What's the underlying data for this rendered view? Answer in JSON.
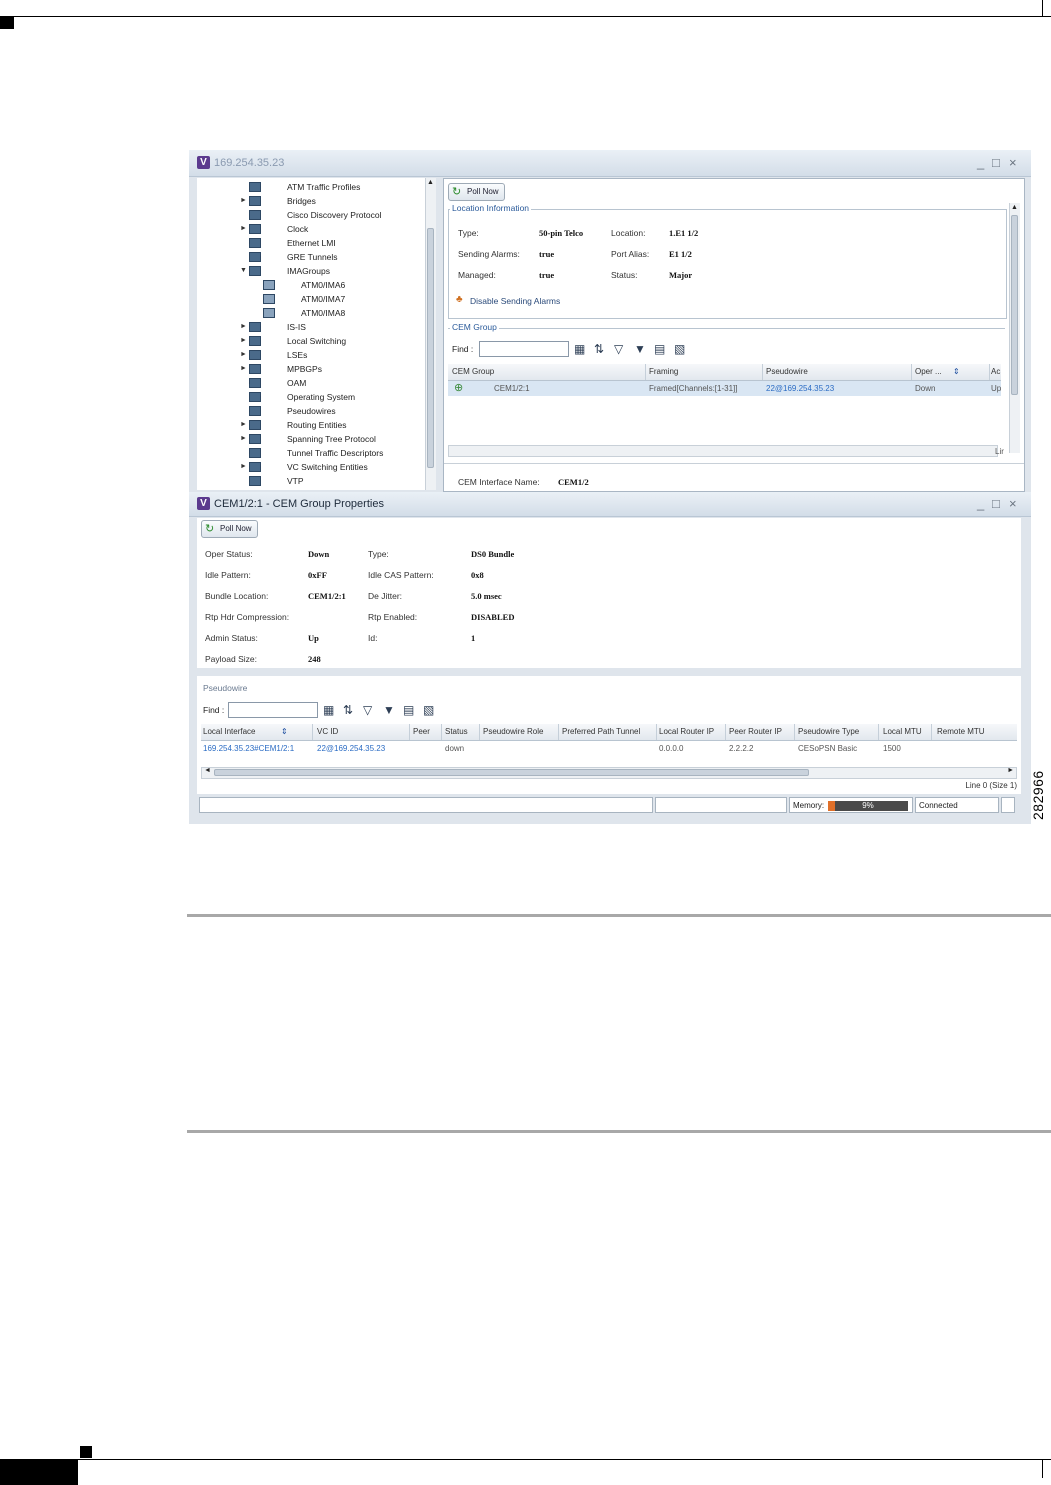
{
  "figure_id": "282966",
  "top_window": {
    "title": "169.254.35.23",
    "poll_now": "Poll Now",
    "tree": [
      {
        "label": "ATM Traffic Profiles",
        "expandable": false
      },
      {
        "label": "Bridges",
        "expandable": true
      },
      {
        "label": "Cisco Discovery Protocol",
        "expandable": false
      },
      {
        "label": "Clock",
        "expandable": true
      },
      {
        "label": "Ethernet LMI",
        "expandable": false
      },
      {
        "label": "GRE Tunnels",
        "expandable": false
      },
      {
        "label": "IMAGroups",
        "expandable": true,
        "expanded": true
      },
      {
        "label": "ATM0/IMA6",
        "child": true
      },
      {
        "label": "ATM0/IMA7",
        "child": true
      },
      {
        "label": "ATM0/IMA8",
        "child": true
      },
      {
        "label": "IS-IS",
        "expandable": true
      },
      {
        "label": "Local Switching",
        "expandable": true
      },
      {
        "label": "LSEs",
        "expandable": true
      },
      {
        "label": "MPBGPs",
        "expandable": true
      },
      {
        "label": "OAM",
        "expandable": false
      },
      {
        "label": "Operating System",
        "expandable": false
      },
      {
        "label": "Pseudowires",
        "expandable": false
      },
      {
        "label": "Routing Entities",
        "expandable": true
      },
      {
        "label": "Spanning Tree Protocol",
        "expandable": true
      },
      {
        "label": "Tunnel Traffic Descriptors",
        "expandable": false
      },
      {
        "label": "VC Switching Entities",
        "expandable": true
      },
      {
        "label": "VTP",
        "expandable": false
      }
    ],
    "location": {
      "section_title": "Location Information",
      "type_label": "Type:",
      "type_value": "50-pin Telco",
      "location_label": "Location:",
      "location_value": "1.E1 1/2",
      "sending_alarms_label": "Sending Alarms:",
      "sending_alarms_value": "true",
      "port_alias_label": "Port Alias:",
      "port_alias_value": "E1 1/2",
      "managed_label": "Managed:",
      "managed_value": "true",
      "status_label": "Status:",
      "status_value": "Major",
      "disable_alarms": "Disable Sending Alarms"
    },
    "cem_group": {
      "section_title": "CEM Group",
      "find_label": "Find :",
      "columns": [
        "CEM Group",
        "Framing",
        "Pseudowire",
        "Oper ...",
        "Ac"
      ],
      "row": {
        "cem_group": "CEM1/2:1",
        "framing": "Framed[Channels:[1-31]]",
        "pseudowire": "22@169.254.35.23",
        "oper": "Down",
        "admin": "Up"
      },
      "line_label": "Lir"
    },
    "cem_interface_label": "CEM Interface Name:",
    "cem_interface_value": "CEM1/2"
  },
  "bottom_window": {
    "title": "CEM1/2:1 - CEM Group Properties",
    "poll_now": "Poll Now",
    "props": {
      "oper_status_label": "Oper Status:",
      "oper_status_value": "Down",
      "type_label": "Type:",
      "type_value": "DS0 Bundle",
      "idle_pattern_label": "Idle Pattern:",
      "idle_pattern_value": "0xFF",
      "idle_cas_label": "Idle CAS Pattern:",
      "idle_cas_value": "0x8",
      "bundle_location_label": "Bundle Location:",
      "bundle_location_value": "CEM1/2:1",
      "de_jitter_label": "De Jitter:",
      "de_jitter_value": "5.0 msec",
      "rtp_hdr_label": "Rtp Hdr Compression:",
      "rtp_enabled_label": "Rtp Enabled:",
      "rtp_enabled_value": "DISABLED",
      "admin_status_label": "Admin Status:",
      "admin_status_value": "Up",
      "id_label": "Id:",
      "id_value": "1",
      "payload_label": "Payload Size:",
      "payload_value": "248"
    },
    "pseudowire": {
      "section_title": "Pseudowire",
      "find_label": "Find :",
      "columns": [
        "Local Interface",
        "VC ID",
        "Peer",
        "Status",
        "Pseudowire Role",
        "Preferred Path Tunnel",
        "Local Router IP",
        "Peer Router IP",
        "Pseudowire Type",
        "Local MTU",
        "Remote MTU"
      ],
      "row": [
        "169.254.35.23#CEM1/2:1",
        "22@169.254.35.23",
        "",
        "down",
        "",
        "",
        "0.0.0.0",
        "2.2.2.2",
        "CESoPSN Basic",
        "1500",
        ""
      ],
      "line_info": "Line 0 (Size 1)"
    },
    "status_bar": {
      "memory_label": "Memory:",
      "memory_percent": "9%",
      "memory_fraction": 0.09,
      "connection": "Connected"
    }
  },
  "colors": {
    "accent": "#2b6cc4",
    "memory_fill": "#e0702a",
    "logo": "#5b3a8e"
  }
}
